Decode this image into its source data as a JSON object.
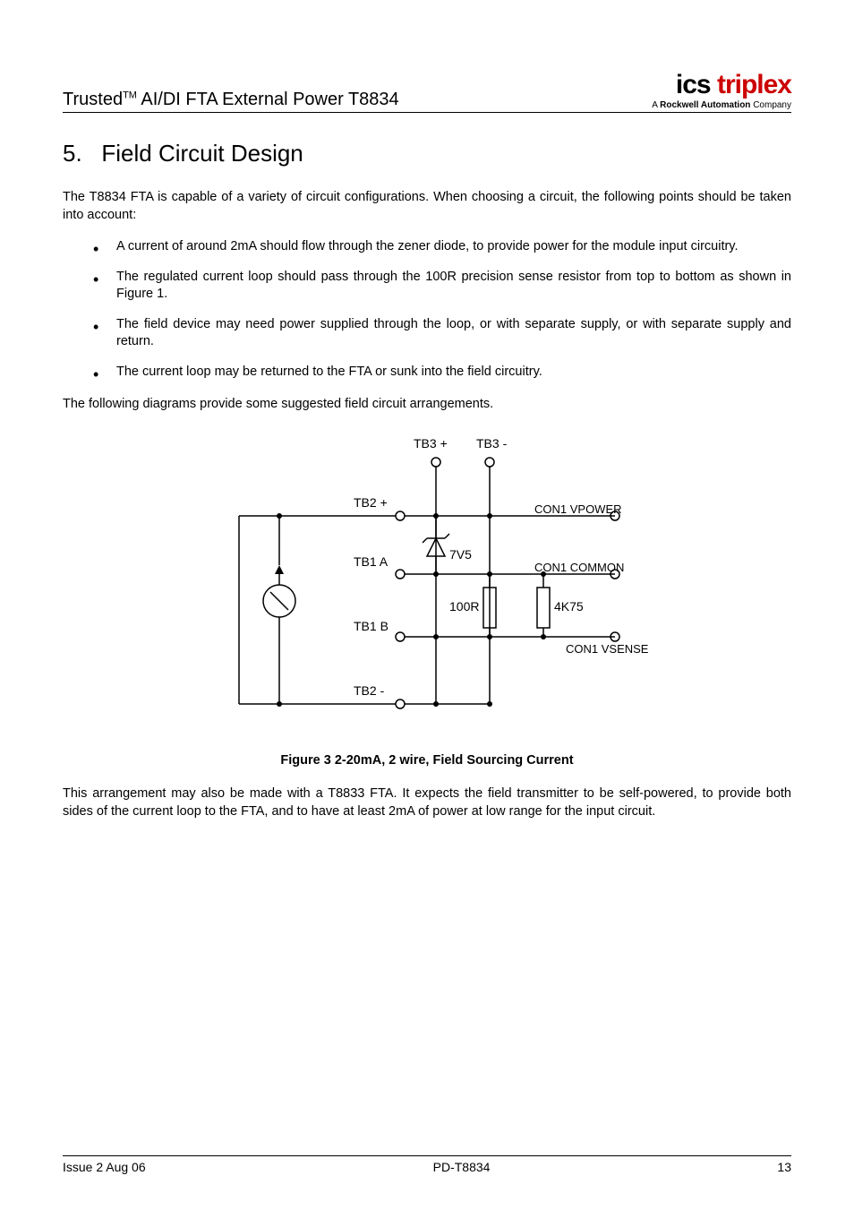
{
  "header": {
    "title_prefix": "Trusted",
    "title_tm": "TM",
    "title_rest": " AI/DI FTA External Power T8834",
    "logo_black": "ics",
    "logo_red": " triplex",
    "logo_sub_prefix": "A ",
    "logo_sub_bold": "Rockwell Automation",
    "logo_sub_suffix": " Company"
  },
  "section": {
    "number": "5.",
    "title": "Field Circuit Design"
  },
  "intro": "The T8834 FTA is capable of a variety of circuit configurations. When choosing a circuit, the following points should be taken into account:",
  "bullets": [
    "A current of around 2mA should flow through the zener diode, to provide power for the module input circuitry.",
    "The regulated current loop should pass through the 100R precision sense resistor from top to bottom as shown in Figure 1.",
    "The field device may need power supplied through the loop, or with separate supply, or with separate supply and return.",
    "The current loop may be returned to the FTA or sunk into the field circuitry."
  ],
  "post_bullets": "The following diagrams provide some suggested field circuit arrangements.",
  "diagram": {
    "tb3_plus": "TB3 +",
    "tb3_minus": "TB3 -",
    "tb2_plus": "TB2 +",
    "tb2_minus": "TB2 -",
    "tb1_a": "TB1 A",
    "tb1_b": "TB1 B",
    "con1_vpower": "CON1 VPOWER",
    "con1_common": "CON1 COMMON",
    "con1_vsense": "CON1 VSENSE",
    "zener": "7V5",
    "r_sense": "100R",
    "r_other": "4K75"
  },
  "figure_caption": "Figure 3 2-20mA, 2 wire, Field Sourcing Current",
  "closing": "This arrangement may also be made with a T8833 FTA. It expects the field transmitter to be self-powered, to provide both sides of the current loop to the FTA, and to have at least 2mA of power at low range for the input circuit.",
  "footer": {
    "left": "Issue 2 Aug 06",
    "center": "PD-T8834",
    "right": "13"
  }
}
